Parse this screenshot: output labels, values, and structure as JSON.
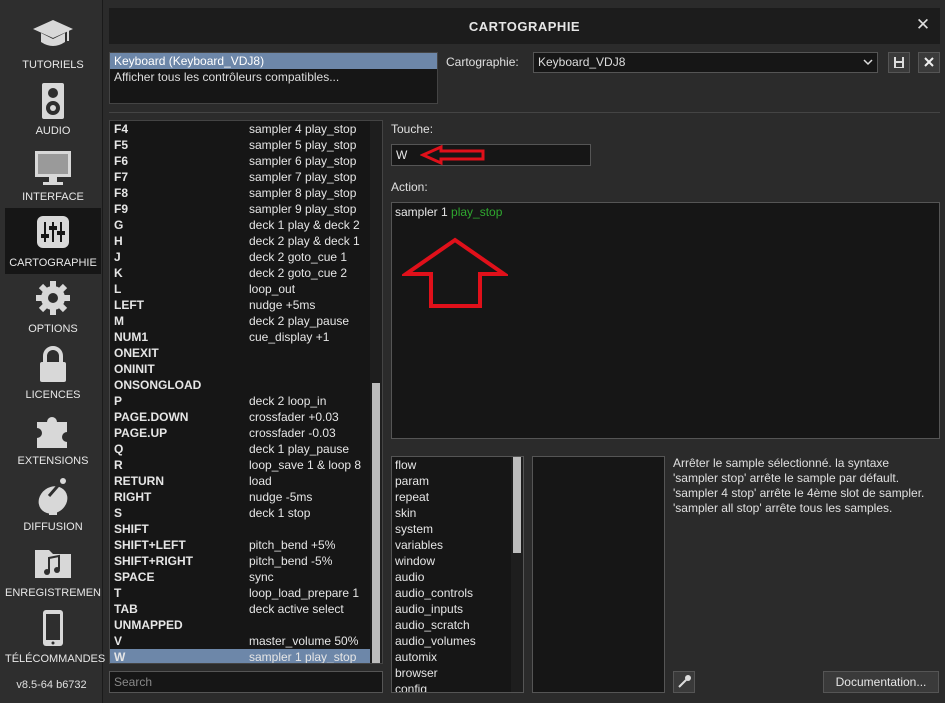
{
  "sidebar": {
    "items": [
      {
        "label": "TUTORIELS",
        "icon": "graduation-cap-icon"
      },
      {
        "label": "AUDIO",
        "icon": "speaker-icon"
      },
      {
        "label": "INTERFACE",
        "icon": "monitor-icon"
      },
      {
        "label": "CARTOGRAPHIE",
        "icon": "sliders-icon",
        "active": true
      },
      {
        "label": "OPTIONS",
        "icon": "gear-icon"
      },
      {
        "label": "LICENCES",
        "icon": "lock-icon"
      },
      {
        "label": "EXTENSIONS",
        "icon": "puzzle-icon"
      },
      {
        "label": "DIFFUSION",
        "icon": "broadcast-dish-icon"
      },
      {
        "label": "ENREGISTREMEN",
        "icon": "music-folder-icon"
      },
      {
        "label": "TÉLÉCOMMANDES",
        "icon": "phone-icon"
      }
    ],
    "version": "v8.5-64 b6732"
  },
  "window": {
    "title": "CARTOGRAPHIE",
    "close": "✕"
  },
  "devices": [
    "Keyboard (Keyboard_VDJ8)",
    "Afficher tous les contrôleurs compatibles..."
  ],
  "cartographie": {
    "label": "Cartographie:",
    "value": "Keyboard_VDJ8"
  },
  "mappings": [
    {
      "key": "F4",
      "action": "sampler  4 play_stop"
    },
    {
      "key": "F5",
      "action": "sampler  5 play_stop"
    },
    {
      "key": "F6",
      "action": "sampler  6 play_stop"
    },
    {
      "key": "F7",
      "action": "sampler  7 play_stop"
    },
    {
      "key": "F8",
      "action": "sampler  8 play_stop"
    },
    {
      "key": "F9",
      "action": "sampler  9 play_stop"
    },
    {
      "key": "G",
      "action": "deck 1 play & deck 2"
    },
    {
      "key": "H",
      "action": "deck 2 play & deck 1"
    },
    {
      "key": "J",
      "action": "deck 2 goto_cue 1"
    },
    {
      "key": "K",
      "action": "deck 2 goto_cue 2"
    },
    {
      "key": "L",
      "action": "loop_out"
    },
    {
      "key": "LEFT",
      "action": "nudge +5ms"
    },
    {
      "key": "M",
      "action": "deck 2 play_pause"
    },
    {
      "key": "NUM1",
      "action": "cue_display +1"
    },
    {
      "key": "ONEXIT",
      "action": ""
    },
    {
      "key": "ONINIT",
      "action": ""
    },
    {
      "key": "ONSONGLOAD",
      "action": ""
    },
    {
      "key": "P",
      "action": "deck 2 loop_in"
    },
    {
      "key": "PAGE.DOWN",
      "action": "crossfader +0.03"
    },
    {
      "key": "PAGE.UP",
      "action": "crossfader -0.03"
    },
    {
      "key": "Q",
      "action": "deck 1 play_pause"
    },
    {
      "key": "R",
      "action": "loop_save 1 & loop 8"
    },
    {
      "key": "RETURN",
      "action": "load"
    },
    {
      "key": "RIGHT",
      "action": "nudge -5ms"
    },
    {
      "key": "S",
      "action": "deck 1 stop"
    },
    {
      "key": "SHIFT",
      "action": ""
    },
    {
      "key": "SHIFT+LEFT",
      "action": "pitch_bend +5%"
    },
    {
      "key": "SHIFT+RIGHT",
      "action": "pitch_bend -5%"
    },
    {
      "key": "SPACE",
      "action": "sync"
    },
    {
      "key": "T",
      "action": "loop_load_prepare 1"
    },
    {
      "key": "TAB",
      "action": "deck active select"
    },
    {
      "key": "UNMAPPED",
      "action": ""
    },
    {
      "key": "V",
      "action": "master_volume 50%"
    },
    {
      "key": "W",
      "action": "sampler 1 play_stop",
      "selected": true
    }
  ],
  "search": {
    "placeholder": "Search"
  },
  "touche": {
    "label": "Touche:",
    "value": "W"
  },
  "action": {
    "label": "Action:",
    "object": "sampler 1",
    "verb": "play_stop"
  },
  "categories": [
    "flow",
    "param",
    "repeat",
    "skin",
    "system",
    "variables",
    "window",
    "audio",
    "audio_controls",
    "audio_inputs",
    "audio_scratch",
    "audio_volumes",
    "automix",
    "browser",
    "config"
  ],
  "help": "Arrêter le sample sélectionné. la syntaxe 'sampler stop' arrête le sample par défault. 'sampler 4 stop' arrête le 4ème slot de sampler. 'sampler all stop' arrête tous les samples.",
  "documentation": "Documentation...",
  "colors": {
    "selection": "#6d87a9",
    "verb": "#2fa82f",
    "annotation": "#e0101a"
  }
}
